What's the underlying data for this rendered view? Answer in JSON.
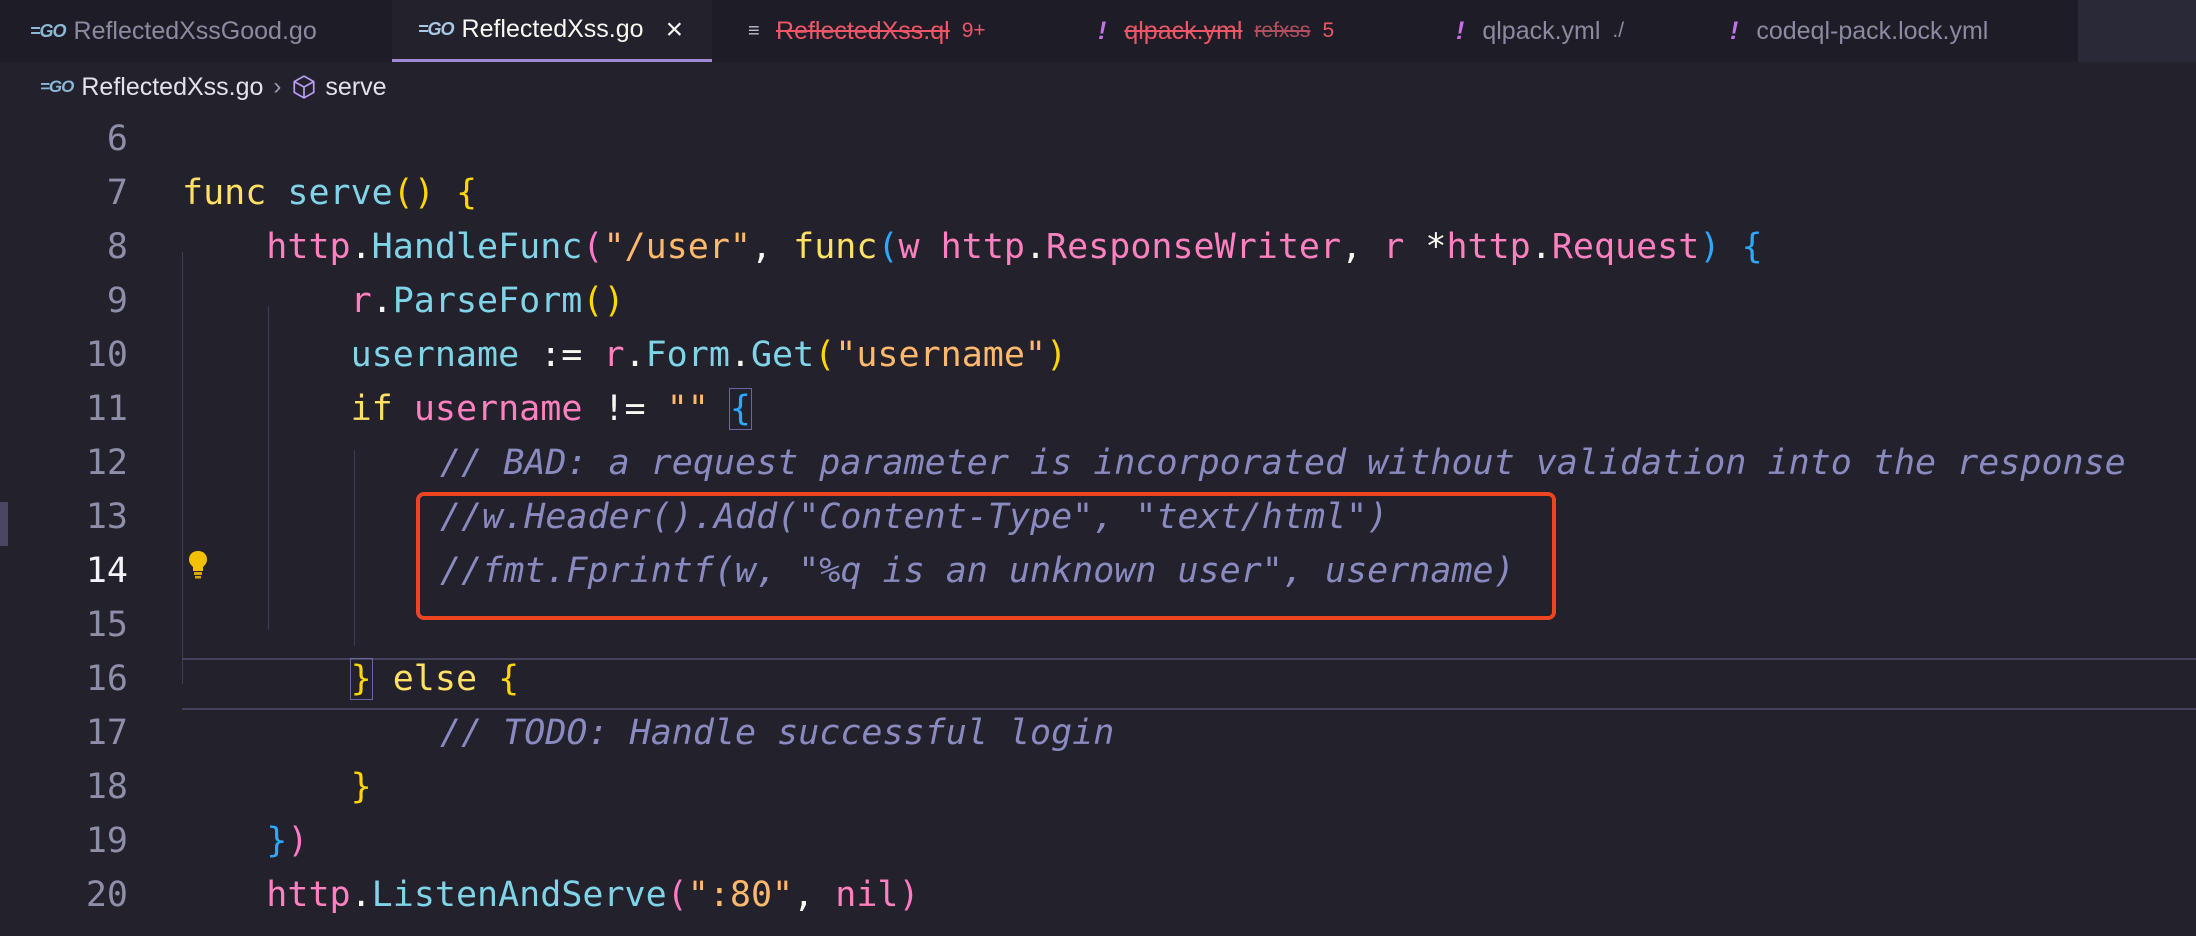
{
  "tabs": [
    {
      "name": "ReflectedXssGood.go"
    },
    {
      "name": "ReflectedXss.go"
    },
    {
      "name": "ReflectedXss.ql",
      "badge": "9+"
    },
    {
      "name": "qlpack.yml",
      "extra": "refxss",
      "badge": "5"
    },
    {
      "name": "qlpack.yml",
      "extra": "./"
    },
    {
      "name": "codeql-pack.lock.yml"
    }
  ],
  "breadcrumb": {
    "file": "ReflectedXss.go",
    "symbol": "serve"
  },
  "code": {
    "line_numbers": [
      "6",
      "7",
      "8",
      "9",
      "10",
      "11",
      "12",
      "13",
      "14",
      "15",
      "16",
      "17",
      "18",
      "19",
      "20"
    ],
    "lines": [
      "",
      "func serve() {",
      "    http.HandleFunc(\"/user\", func(w http.ResponseWriter, r *http.Request) {",
      "        r.ParseForm()",
      "        username := r.Form.Get(\"username\")",
      "        if username != \"\" {",
      "            // BAD: a request parameter is incorporated without validation into the response",
      "            //w.Header().Add(\"Content-Type\", \"text/html\")",
      "            //fmt.Fprintf(w, \"%q is an unknown user\", username)",
      "",
      "        } else {",
      "            // TODO: Handle successful login",
      "        }",
      "    })",
      "    http.ListenAndServe(\":80\", nil)"
    ],
    "current_line": "14"
  },
  "colors": {
    "background": "#22212c",
    "highlight_box": "#ee4422",
    "keyword": "#ffe066",
    "function": "#81d4e8",
    "package": "#ff80bf",
    "string": "#ffb86c",
    "comment": "#8a8ac0"
  }
}
